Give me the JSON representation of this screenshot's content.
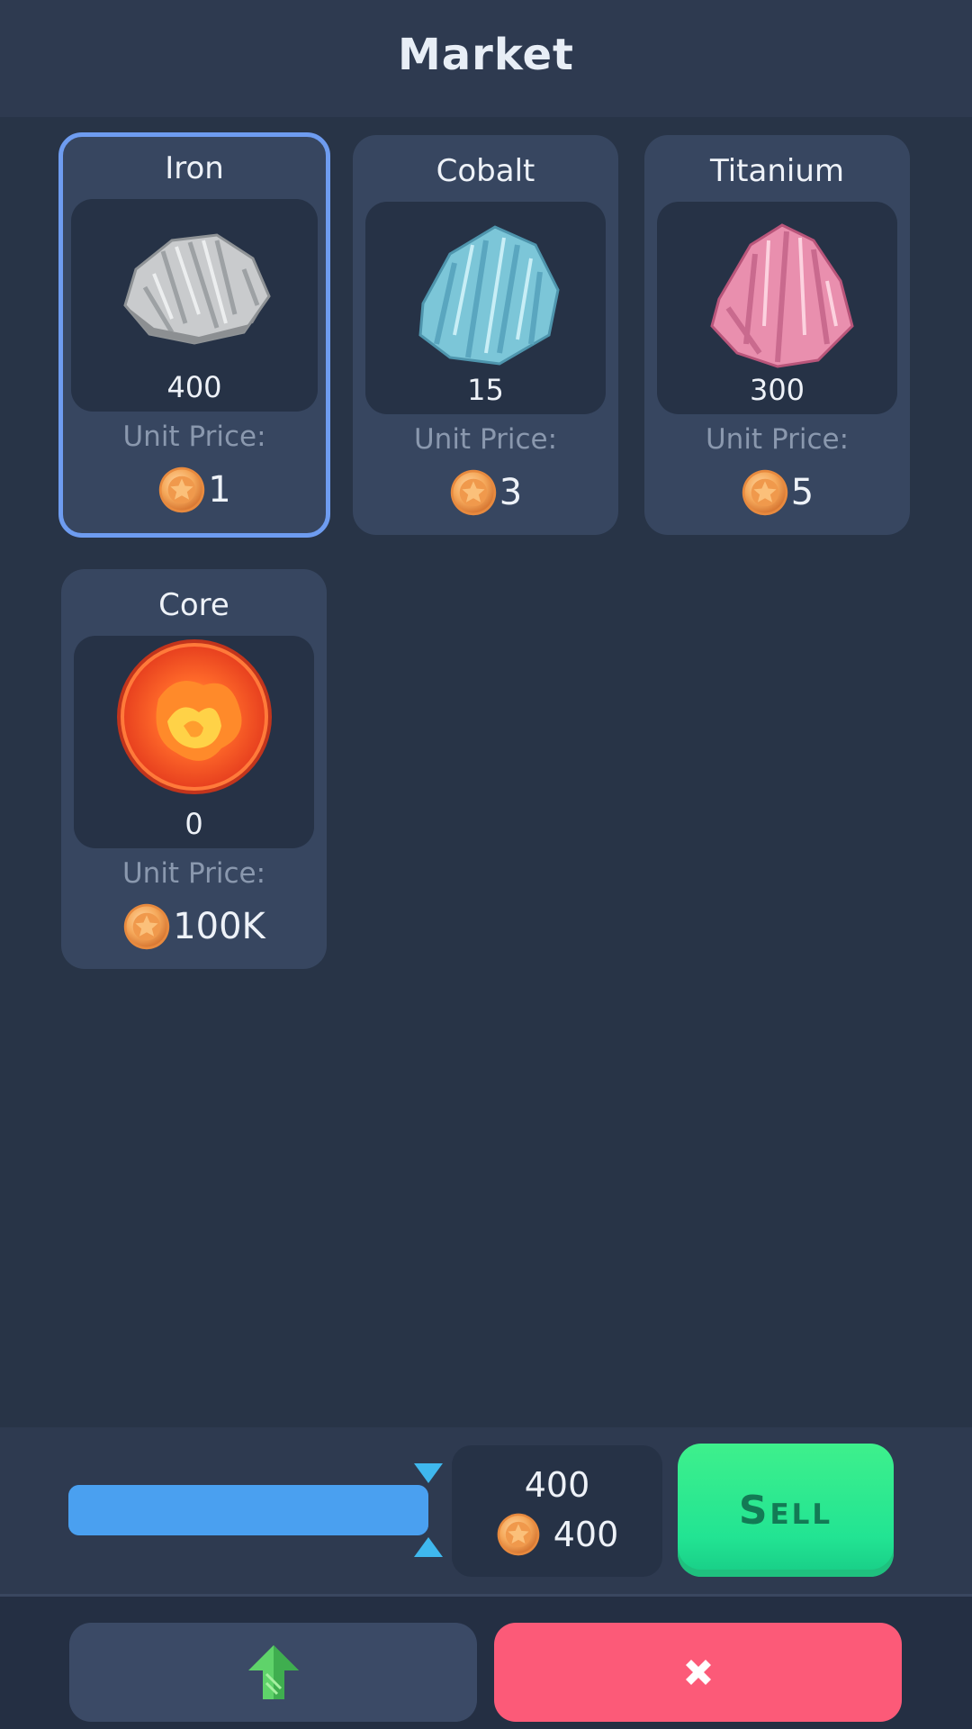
{
  "header": {
    "title": "Market"
  },
  "items": [
    {
      "name": "Iron",
      "quantity": "400",
      "unit_price_label": "Unit Price:",
      "price": "1",
      "icon": "iron-ore-icon",
      "selected": true
    },
    {
      "name": "Cobalt",
      "quantity": "15",
      "unit_price_label": "Unit Price:",
      "price": "3",
      "icon": "cobalt-ore-icon",
      "selected": false
    },
    {
      "name": "Titanium",
      "quantity": "300",
      "unit_price_label": "Unit Price:",
      "price": "5",
      "icon": "titanium-ore-icon",
      "selected": false
    },
    {
      "name": "Core",
      "quantity": "0",
      "unit_price_label": "Unit Price:",
      "price": "100K",
      "icon": "core-orb-icon",
      "selected": false
    }
  ],
  "sell_panel": {
    "slider_fraction": 1.0,
    "sell_quantity": "400",
    "sell_total": "400",
    "sell_label": "Sell"
  },
  "footer": {
    "upgrade_icon": "up-arrow-icon",
    "close_icon": "close-x-icon"
  },
  "colors": {
    "background": "#283447",
    "card": "#374660",
    "selected_border": "#6e9cf0",
    "sell_button": "#22e493",
    "close_button": "#fc5a78",
    "slider": "#4aa0f0"
  }
}
